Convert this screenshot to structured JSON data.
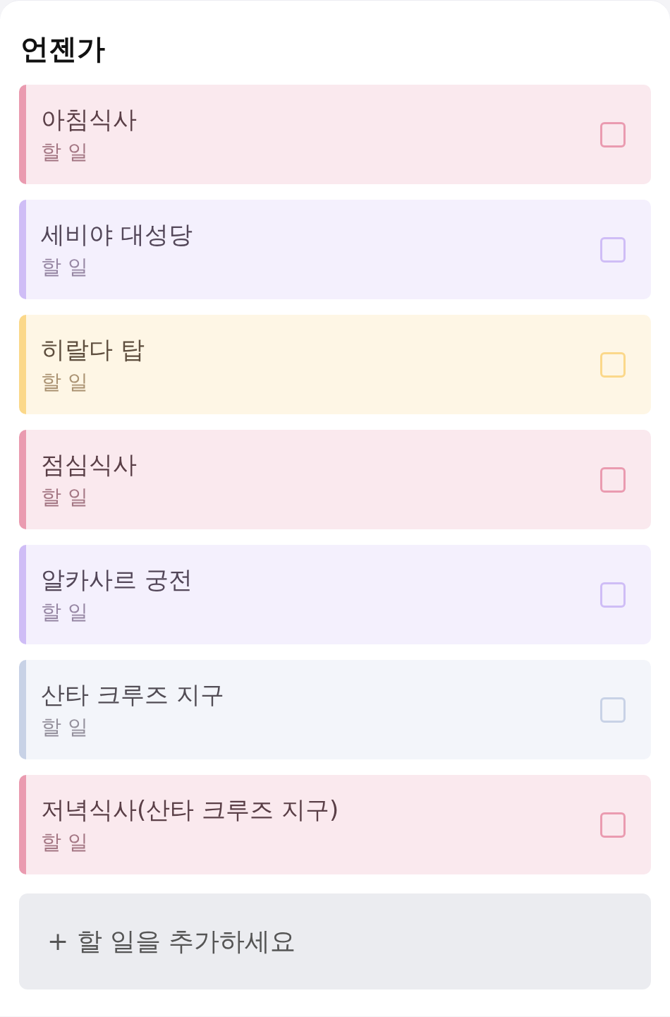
{
  "section": {
    "title": "언젠가"
  },
  "tasks": [
    {
      "title": "아침식사",
      "subtitle": "할 일",
      "color": "#ea9bb0",
      "checked": false
    },
    {
      "title": "세비야 대성당",
      "subtitle": "할 일",
      "color": "#cfbdf6",
      "checked": false
    },
    {
      "title": "히랄다 탑",
      "subtitle": "할 일",
      "color": "#fbd88a",
      "checked": false
    },
    {
      "title": "점심식사",
      "subtitle": "할 일",
      "color": "#ea9bb0",
      "checked": false
    },
    {
      "title": "알카사르 궁전",
      "subtitle": "할 일",
      "color": "#cfbdf6",
      "checked": false
    },
    {
      "title": "산타 크루즈 지구",
      "subtitle": "할 일",
      "color": "#c8d2e6",
      "checked": false
    },
    {
      "title": "저녁식사(산타 크루즈 지구)",
      "subtitle": "할 일",
      "color": "#ea9bb0",
      "checked": false
    }
  ],
  "add_task": {
    "label": "+ 할 일을 추가하세요"
  }
}
